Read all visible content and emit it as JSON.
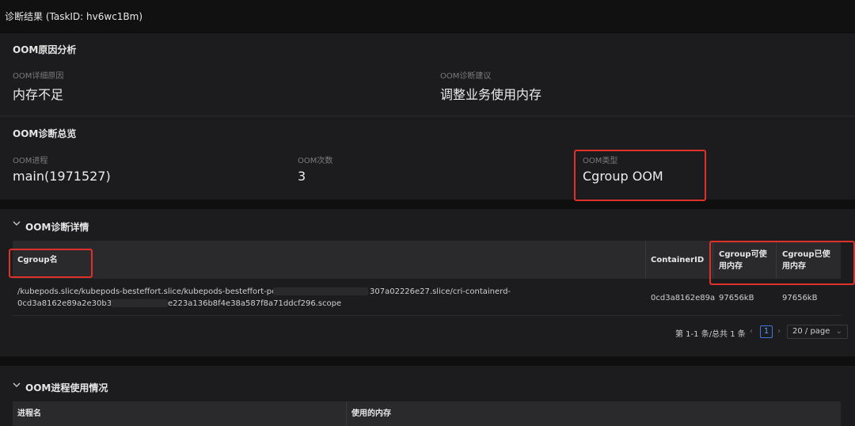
{
  "window": {
    "title": "诊断结果 (TaskID: hv6wc1Bm)"
  },
  "oom_cause": {
    "title": "OOM原因分析",
    "detail_label": "OOM详细原因",
    "detail_value": "内存不足",
    "advice_label": "OOM诊断建议",
    "advice_value": "调整业务使用内存"
  },
  "oom_overview": {
    "title": "OOM诊断总览",
    "process_label": "OOM进程",
    "process_value": "main(1971527)",
    "count_label": "OOM次数",
    "count_value": "3",
    "type_label": "OOM类型",
    "type_value": "Cgroup OOM"
  },
  "oom_detail": {
    "title": "OOM诊断详情",
    "columns": [
      "Cgroup名",
      "ContainerID",
      "Cgroup可使用内存",
      "Cgroup已使用内存"
    ],
    "rows": [
      {
        "cgroup_line1a": "/kubepods.slice/kubepods-besteffort.slice/kubepods-besteffort-pod9",
        "cgroup_line1b": "307a02226e27.slice/cri-containerd-",
        "cgroup_line2a": "0cd3a8162e89a2e30b33",
        "cgroup_line2b": "e223a136b8f4e38a587f8a71ddcf296.scope",
        "container_id": "0cd3a8162e89a",
        "available": "97656kB",
        "used": "97656kB"
      }
    ],
    "pagination": {
      "summary": "第 1-1 条/总共 1 条",
      "current_page": "1",
      "page_size": "20 / page"
    }
  },
  "oom_process": {
    "title": "OOM进程使用情况",
    "columns": [
      "进程名",
      "使用的内存"
    ]
  },
  "colors": {
    "highlight": "#e0302a",
    "accent": "#3d7ae0",
    "card": "#1c1c1e",
    "background": "#0f0f10"
  }
}
